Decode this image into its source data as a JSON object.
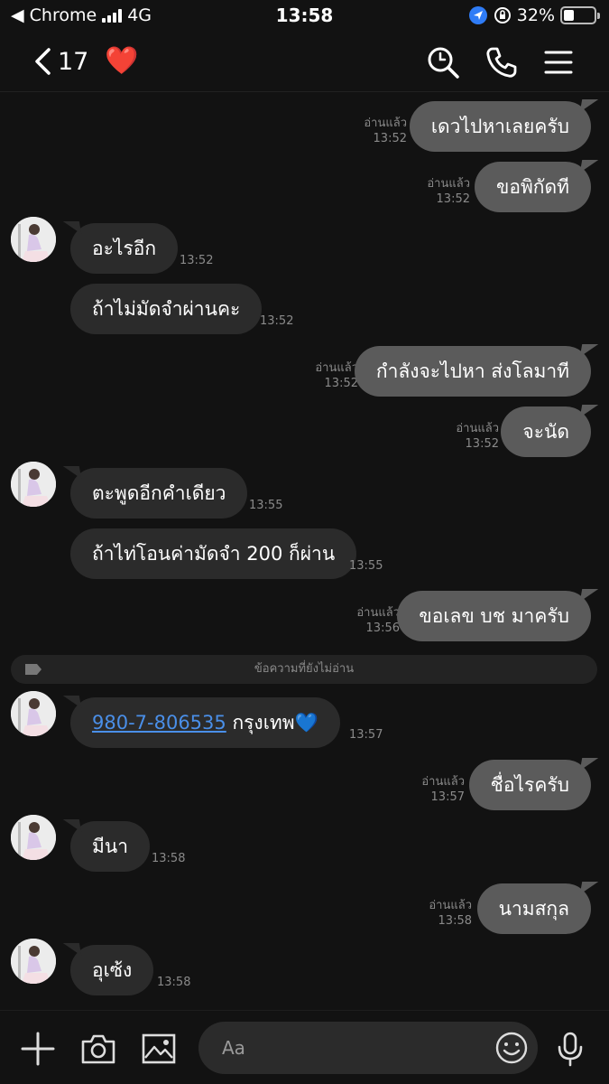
{
  "status": {
    "back_app": "◀ Chrome",
    "network": "4G",
    "time": "13:58",
    "battery": "32%"
  },
  "header": {
    "unread_count": "17",
    "heart": "❤️",
    "icons": [
      "search-icon",
      "phone-icon",
      "menu-icon"
    ]
  },
  "messages": [
    {
      "side": "out",
      "text": "เดวไปหาเลยครับ",
      "read": "อ่านแล้ว",
      "time": "13:52"
    },
    {
      "side": "out",
      "text": "ขอพิกัดที",
      "read": "อ่านแล้ว",
      "time": "13:52"
    },
    {
      "side": "in",
      "text": "อะไรอีก",
      "time": "13:52"
    },
    {
      "side": "in",
      "text": "ถ้าไม่มัดจำผ่านคะ",
      "time": "13:52"
    },
    {
      "side": "out",
      "text": "กำลังจะไปหา ส่งโลมาที",
      "read": "อ่านแล้ว",
      "time": "13:52"
    },
    {
      "side": "out",
      "text": "จะนัด",
      "read": "อ่านแล้ว",
      "time": "13:52"
    },
    {
      "side": "in",
      "text": "ตะพูดอีกคำเดียว",
      "time": "13:55"
    },
    {
      "side": "in",
      "text": "ถ้าไท่โอนค่ามัดจำ 200 ก็ผ่าน",
      "time": "13:55"
    },
    {
      "side": "out",
      "text": "ขอเลข บช มาครับ",
      "read": "อ่านแล้ว",
      "time": "13:56"
    },
    {
      "side": "in",
      "link": "980-7-806535",
      "text": " กรุงเทพ",
      "emoji": "💙",
      "time": "13:57"
    },
    {
      "side": "out",
      "text": "ชื่อไรครับ",
      "read": "อ่านแล้ว",
      "time": "13:57"
    },
    {
      "side": "in",
      "text": "มีนา",
      "time": "13:58"
    },
    {
      "side": "out",
      "text": "นามสกุล",
      "read": "อ่านแล้ว",
      "time": "13:58"
    },
    {
      "side": "in",
      "text": "อุเซ้ง",
      "time": "13:58"
    }
  ],
  "unread_divider": "ข้อความที่ยังไม่อ่าน",
  "composer": {
    "placeholder": "Aa",
    "icons": [
      "plus-icon",
      "camera-icon",
      "image-icon",
      "emoji-icon",
      "microphone-icon"
    ]
  },
  "colors": {
    "background": "#121212",
    "incoming_bubble": "#2b2b2b",
    "outgoing_bubble": "#5b5b5b",
    "link": "#4a8fe8",
    "heart": "#e31b23"
  }
}
